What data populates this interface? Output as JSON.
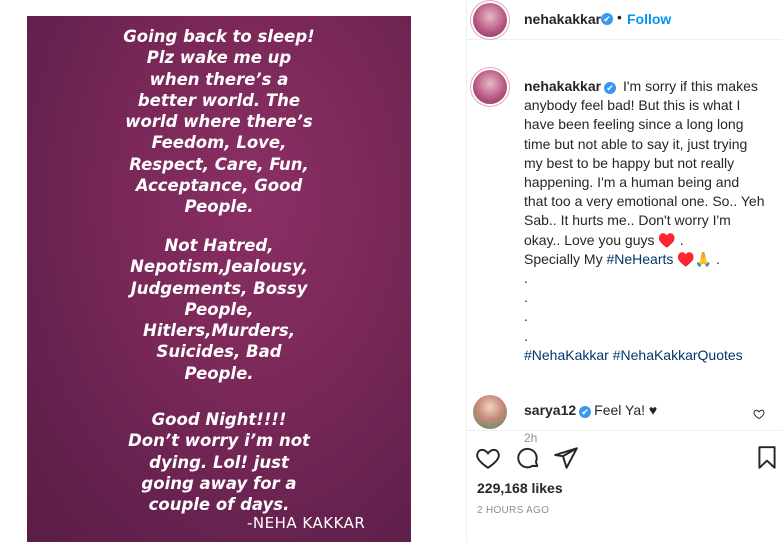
{
  "post": {
    "story_text": {
      "paragraph1": "Going back to sleep!\nPlz wake me up\nwhen there’s a\nbetter world. The\nworld where there’s\nFeedom, Love,\nRespect, Care, Fun,\nAcceptance, Good\nPeople.",
      "paragraph2": "Not Hatred,\nNepotism,Jealousy,\nJudgements, Bossy\nPeople,\nHitlers,Murders,\nSuicides, Bad\nPeople.",
      "paragraph3": "Good Night!!!!\nDon’t worry i’m not\ndying. Lol! just\ngoing away for a\ncouple of days.",
      "signature": "-NEHA KAKKAR"
    }
  },
  "header": {
    "username": "nehakakkar",
    "verified_icon": "✔",
    "separator": "•",
    "follow_label": "Follow"
  },
  "caption": {
    "username": "nehakakkar",
    "verified_icon": "✔",
    "lines": [
      "I'm sorry if this makes",
      "anybody feel bad! But this is what I",
      "have been feeling since a long long",
      "time but not able to say it, just trying",
      "my best to be happy but not really",
      "happening. I'm a human being and",
      "that too a very emotional one. So.. Yeh",
      "Sab.. It hurts me.. Don't worry I'm",
      "okay.. Love you guys ♥️ .",
      "Specially My "
    ],
    "special_hashtag": "#NeHearts",
    "special_suffix": " ♥️🙏 .",
    "dots": [
      ".",
      ".",
      ".",
      "."
    ],
    "hashtag_1": "#NehaKakkar",
    "hashtag_2": "#NehaKakkarQuotes",
    "time_ago": "2h"
  },
  "comment": {
    "username": "sarya12",
    "verified_icon": "✔",
    "text": "Feel Ya! ♥"
  },
  "actions": {
    "like_icon": "heart-icon",
    "comment_icon": "comment-icon",
    "share_icon": "share-icon",
    "save_icon": "bookmark-icon"
  },
  "likes": "229,168 likes",
  "posted_time": "2 HOURS AGO"
}
